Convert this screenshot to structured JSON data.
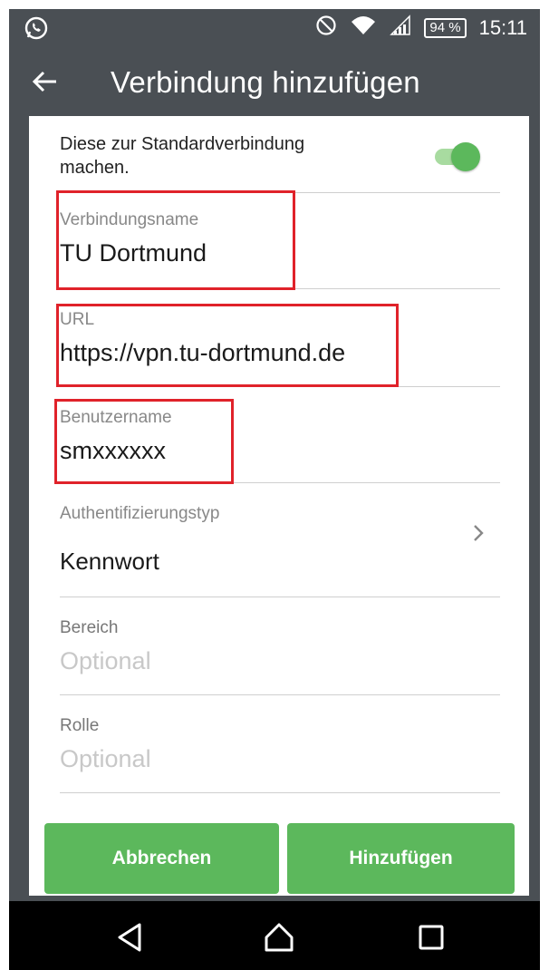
{
  "status_bar": {
    "battery": "94 %",
    "time": "15:11",
    "icons": [
      "whatsapp-icon",
      "do-not-disturb-icon",
      "wifi-icon",
      "signal-icon",
      "battery-icon"
    ]
  },
  "app_bar": {
    "title": "Verbindung hinzufügen",
    "back_icon": "arrow-left-icon"
  },
  "form": {
    "default_toggle": {
      "label": "Diese zur Standardverbindung machen.",
      "on": true
    },
    "connection_name": {
      "label": "Verbindungsname",
      "value": "TU Dortmund"
    },
    "url": {
      "label": "URL",
      "value": "https://vpn.tu-dortmund.de"
    },
    "username": {
      "label": "Benutzername",
      "value": "smxxxxxx"
    },
    "auth_type": {
      "label": "Authentifizierungstyp",
      "value": "Kennwort"
    },
    "realm": {
      "label": "Bereich",
      "placeholder": "Optional"
    },
    "role": {
      "label": "Rolle",
      "placeholder": "Optional"
    }
  },
  "buttons": {
    "cancel": "Abbrechen",
    "add": "Hinzufügen"
  },
  "colors": {
    "appbar": "#4a4f54",
    "accent": "#5cb85c",
    "highlight": "#e0222a"
  }
}
